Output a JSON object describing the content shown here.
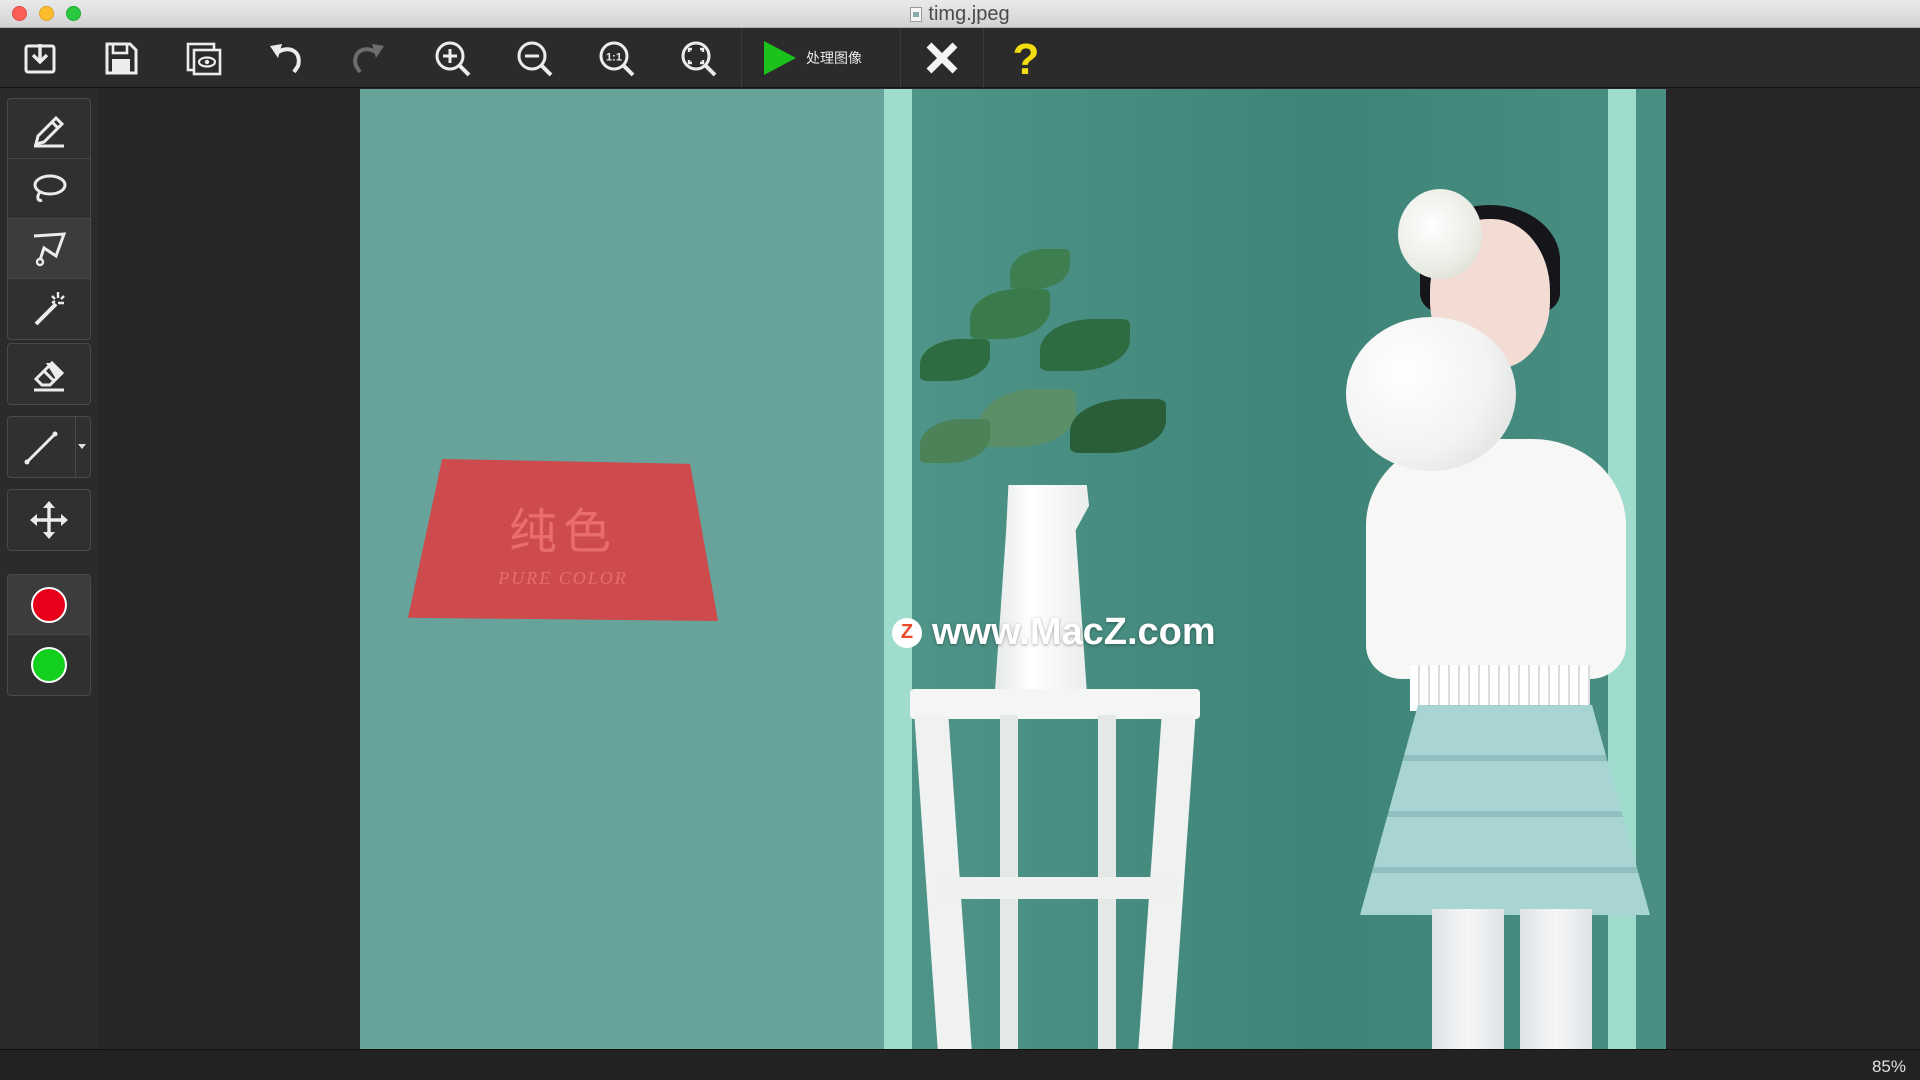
{
  "window": {
    "title": "timg.jpeg"
  },
  "toolbar": {
    "buttons": [
      {
        "name": "open-button",
        "icon": "import-icon"
      },
      {
        "name": "save-button",
        "icon": "save-icon"
      },
      {
        "name": "preview-button",
        "icon": "preview-icon"
      },
      {
        "name": "undo-button",
        "icon": "undo-icon"
      },
      {
        "name": "redo-button",
        "icon": "redo-icon"
      },
      {
        "name": "zoom-in-button",
        "icon": "zoom-in-icon"
      },
      {
        "name": "zoom-out-button",
        "icon": "zoom-out-icon"
      },
      {
        "name": "actual-size-button",
        "icon": "zoom-actual-icon",
        "label": "1:1"
      },
      {
        "name": "fit-button",
        "icon": "zoom-fit-icon"
      }
    ],
    "process_label": "处理图像",
    "cancel_icon": "close-icon",
    "help_label": "?"
  },
  "tools": {
    "group1": [
      "marker-icon",
      "lasso-icon",
      "polygon-lasso-icon",
      "magic-wand-icon"
    ],
    "group2": [
      "eraser-icon"
    ],
    "group3": [
      "line-icon"
    ],
    "group4": [
      "move-icon"
    ],
    "colors": {
      "foreground": "#e8001a",
      "background": "#14d01e"
    }
  },
  "canvas": {
    "sign": {
      "cn": "纯色",
      "en": "PURE COLOR"
    },
    "watermark": {
      "logo": "Z",
      "text": "www.MacZ.com"
    }
  },
  "status": {
    "zoom": "85%"
  },
  "colors": {
    "accent_green": "#1cc21c",
    "help_yellow": "#f2dd0f",
    "panel": "#2b2b2b"
  }
}
